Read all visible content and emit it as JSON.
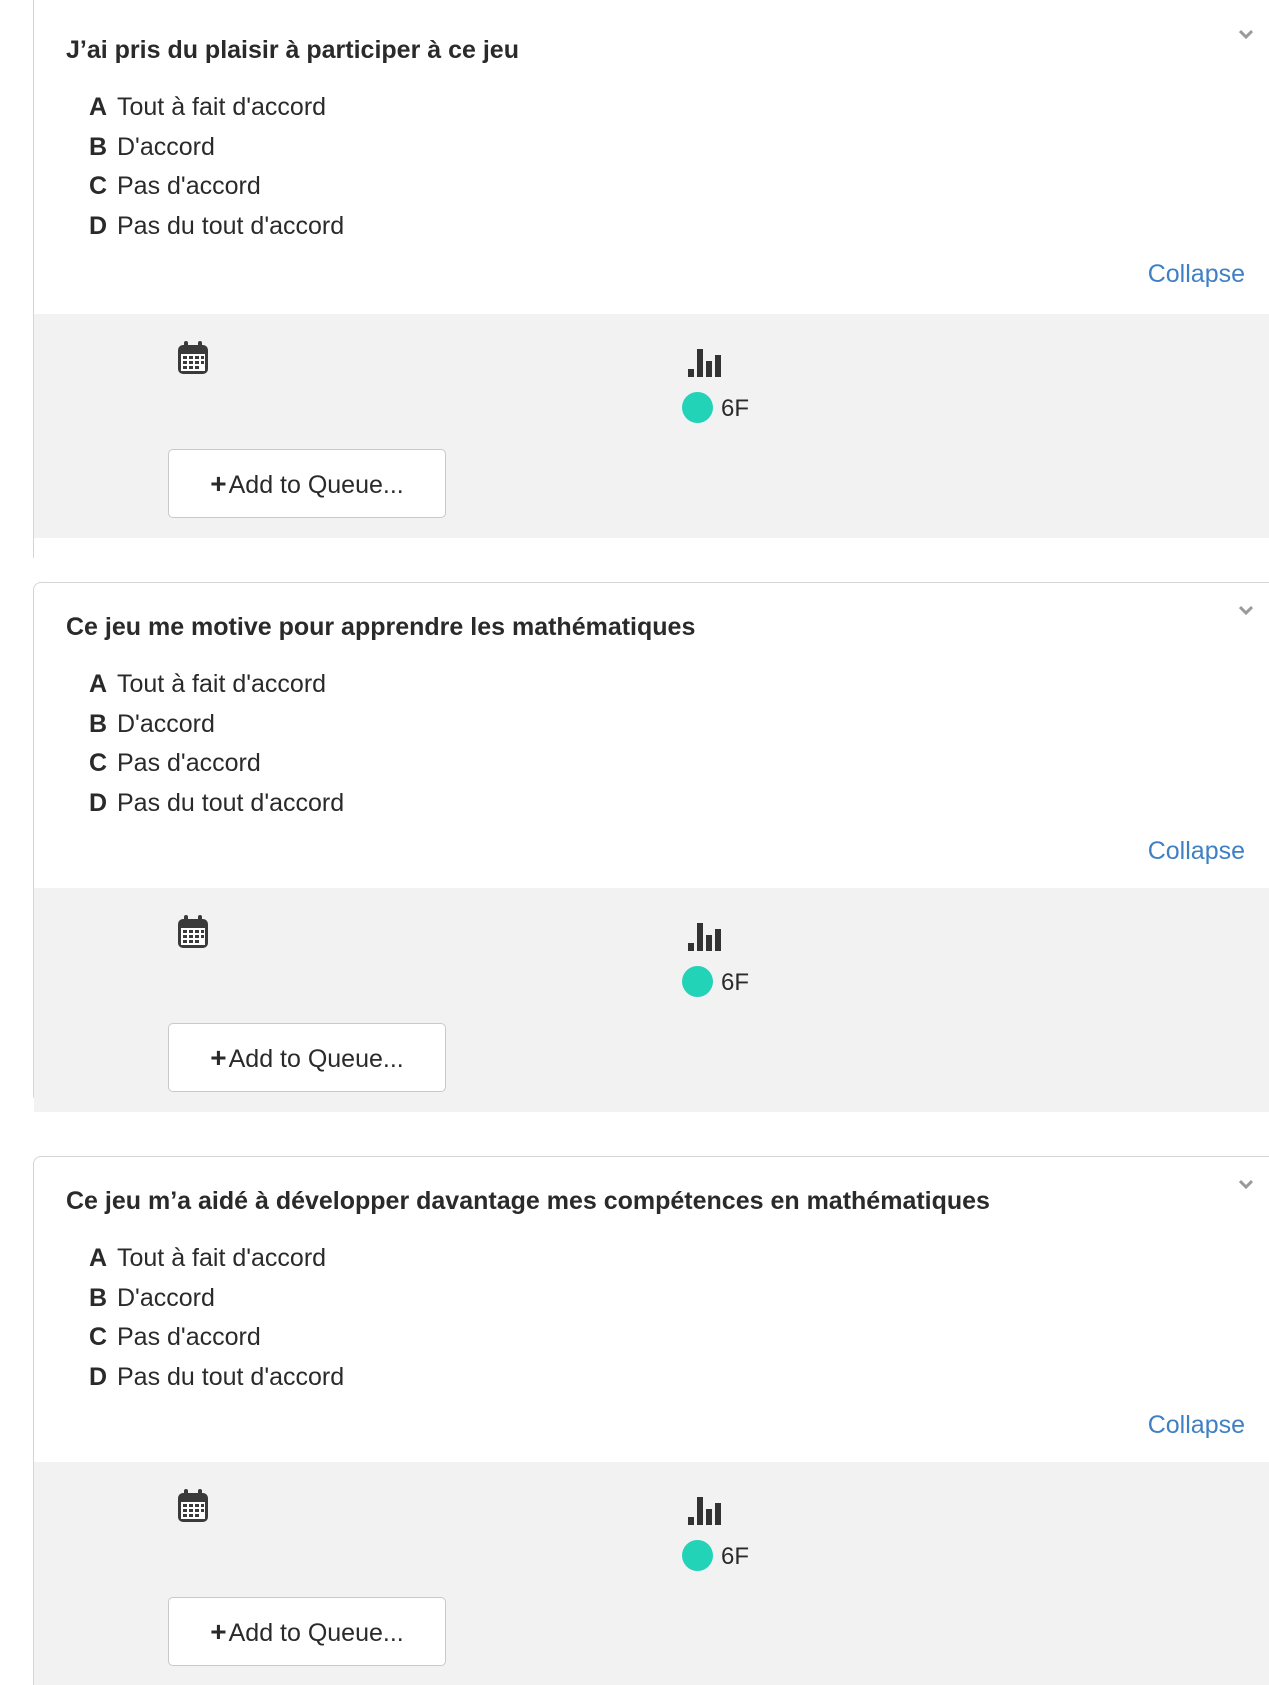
{
  "questions": [
    {
      "title": "J’ai pris du plaisir à participer à ce jeu",
      "options": [
        {
          "letter": "A",
          "text": "Tout à fait d'accord"
        },
        {
          "letter": "B",
          "text": "D'accord"
        },
        {
          "letter": "C",
          "text": "Pas d'accord"
        },
        {
          "letter": "D",
          "text": "Pas du tout d'accord"
        }
      ],
      "collapse_label": "Collapse",
      "group_label": "6F",
      "queue_label": "Add to Queue..."
    },
    {
      "title": "Ce jeu me motive pour apprendre les mathématiques",
      "options": [
        {
          "letter": "A",
          "text": "Tout à fait d'accord"
        },
        {
          "letter": "B",
          "text": "D'accord"
        },
        {
          "letter": "C",
          "text": "Pas d'accord"
        },
        {
          "letter": "D",
          "text": "Pas du tout d'accord"
        }
      ],
      "collapse_label": "Collapse",
      "group_label": "6F",
      "queue_label": "Add to Queue..."
    },
    {
      "title": "Ce jeu m’a aidé à développer davantage mes compétences en mathématiques",
      "options": [
        {
          "letter": "A",
          "text": "Tout à fait d'accord"
        },
        {
          "letter": "B",
          "text": "D'accord"
        },
        {
          "letter": "C",
          "text": "Pas d'accord"
        },
        {
          "letter": "D",
          "text": "Pas du tout d'accord"
        }
      ],
      "collapse_label": "Collapse",
      "group_label": "6F",
      "queue_label": "Add to Queue..."
    }
  ],
  "colors": {
    "link": "#3f80c4",
    "group_dot": "#22d3b8",
    "panel_bg": "#f2f2f2"
  },
  "icons": {
    "expand": "chevron-down-icon",
    "date": "calendar-icon",
    "stats": "bar-chart-icon",
    "add": "plus-icon",
    "group": "group-dot-icon"
  }
}
